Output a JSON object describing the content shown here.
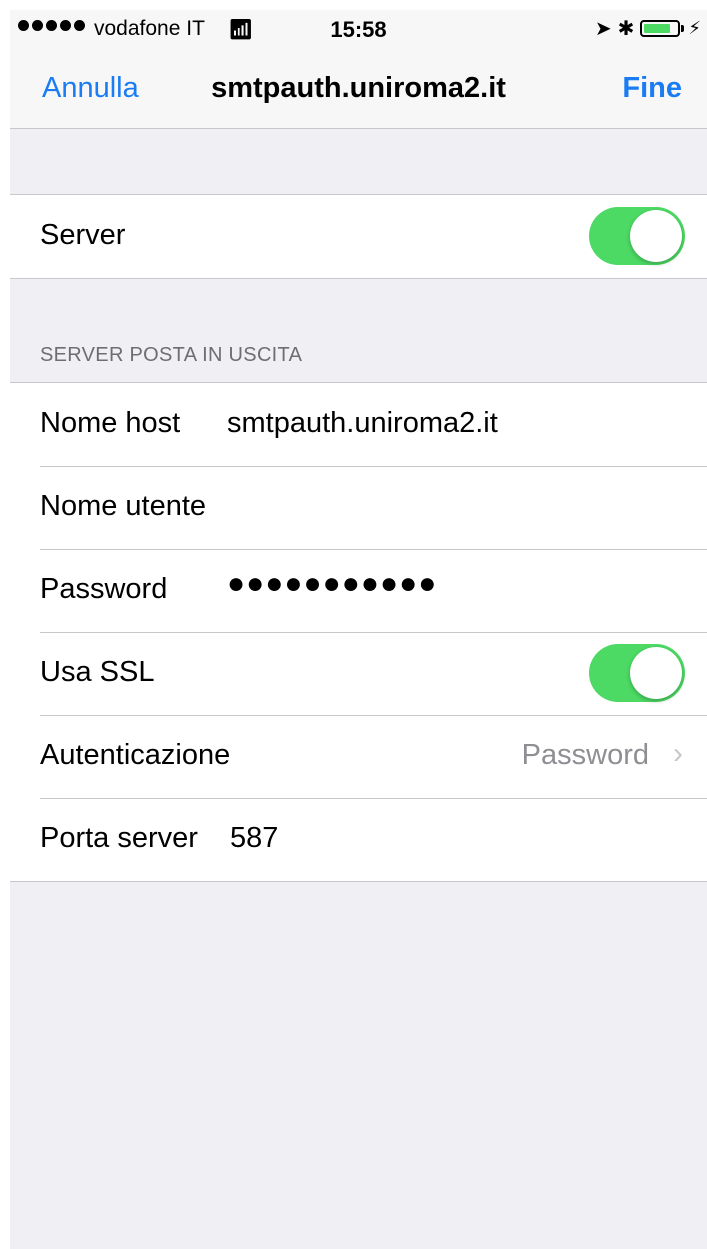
{
  "status_bar": {
    "carrier": "vodafone IT",
    "time": "15:58",
    "wifi_icon": "wifi-icon",
    "location_icon": "location-arrow-icon",
    "bluetooth_icon": "bluetooth-icon",
    "battery_level": 0.8,
    "battery_color": "#4cd964"
  },
  "nav": {
    "cancel": "Annulla",
    "title": "smtpauth.uniroma2.it",
    "done": "Fine",
    "accent_color": "#1a7cf3"
  },
  "server_group": {
    "server_label": "Server",
    "server_enabled": true
  },
  "outgoing": {
    "header": "SERVER POSTA IN USCITA",
    "host_label": "Nome host",
    "host_value": "smtpauth.uniroma2.it",
    "user_label": "Nome utente",
    "user_value": "",
    "password_label": "Password",
    "password_value": "●●●●●●●●●●●",
    "ssl_label": "Usa SSL",
    "ssl_enabled": true,
    "auth_label": "Autenticazione",
    "auth_value": "Password",
    "port_label": "Porta server",
    "port_value": "587"
  }
}
